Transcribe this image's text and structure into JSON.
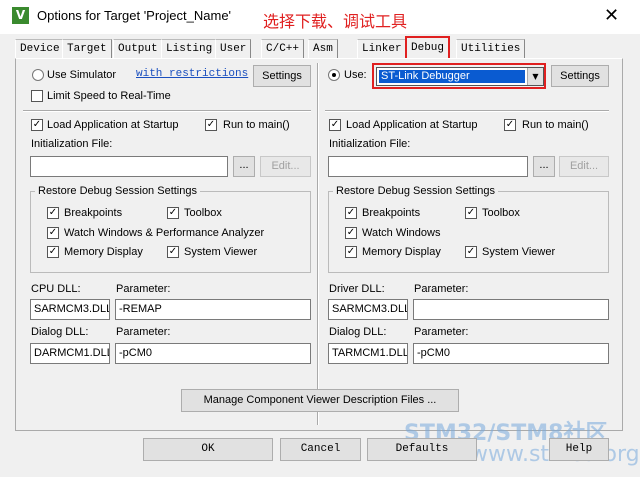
{
  "window": {
    "title": "Options for Target 'Project_Name'",
    "annotation": "选择下载、调试工具",
    "close": "✕",
    "app_icon": "V"
  },
  "tabs": [
    "Device",
    "Target",
    "Output",
    "Listing",
    "User",
    "C/C++",
    "Asm",
    "Linker",
    "Debug",
    "Utilities"
  ],
  "active_tab": "Debug",
  "left": {
    "use_simulator": "Use Simulator",
    "restrictions_link": "with restrictions",
    "settings": "Settings",
    "limit_speed": "Limit Speed to Real-Time",
    "load_app": "Load Application at Startup",
    "run_main": "Run to main()",
    "init_file_label": "Initialization File:",
    "init_file_value": "",
    "browse": "...",
    "edit": "Edit...",
    "restore_title": "Restore Debug Session Settings",
    "breakpoints": "Breakpoints",
    "toolbox": "Toolbox",
    "watch": "Watch Windows & Performance Analyzer",
    "memory": "Memory Display",
    "system_viewer": "System Viewer",
    "cpu_dll_label": "CPU DLL:",
    "cpu_dll_value": "SARMCM3.DLL",
    "param_label": "Parameter:",
    "cpu_param_value": "-REMAP",
    "dialog_dll_label": "Dialog DLL:",
    "dialog_dll_value": "DARMCM1.DLL",
    "dialog_param_value": "-pCM0"
  },
  "right": {
    "use": "Use:",
    "debugger": "ST-Link Debugger",
    "settings": "Settings",
    "load_app": "Load Application at Startup",
    "run_main": "Run to main()",
    "init_file_label": "Initialization File:",
    "init_file_value": "",
    "browse": "...",
    "edit": "Edit...",
    "restore_title": "Restore Debug Session Settings",
    "breakpoints": "Breakpoints",
    "toolbox": "Toolbox",
    "watch": "Watch Windows",
    "memory": "Memory Display",
    "system_viewer": "System Viewer",
    "driver_dll_label": "Driver DLL:",
    "driver_dll_value": "SARMCM3.DLL",
    "param_label": "Parameter:",
    "driver_param_value": "",
    "dialog_dll_label": "Dialog DLL:",
    "dialog_dll_value": "TARMCM1.DLL",
    "dialog_param_value": "-pCM0"
  },
  "manage_button": "Manage Component Viewer Description Files ...",
  "footer": {
    "ok": "OK",
    "cancel": "Cancel",
    "defaults": "Defaults",
    "help": "Help"
  },
  "watermark": {
    "line1": "STM32/STM8社区",
    "line2": "www.stmcu.org"
  },
  "checkmark": "✓"
}
